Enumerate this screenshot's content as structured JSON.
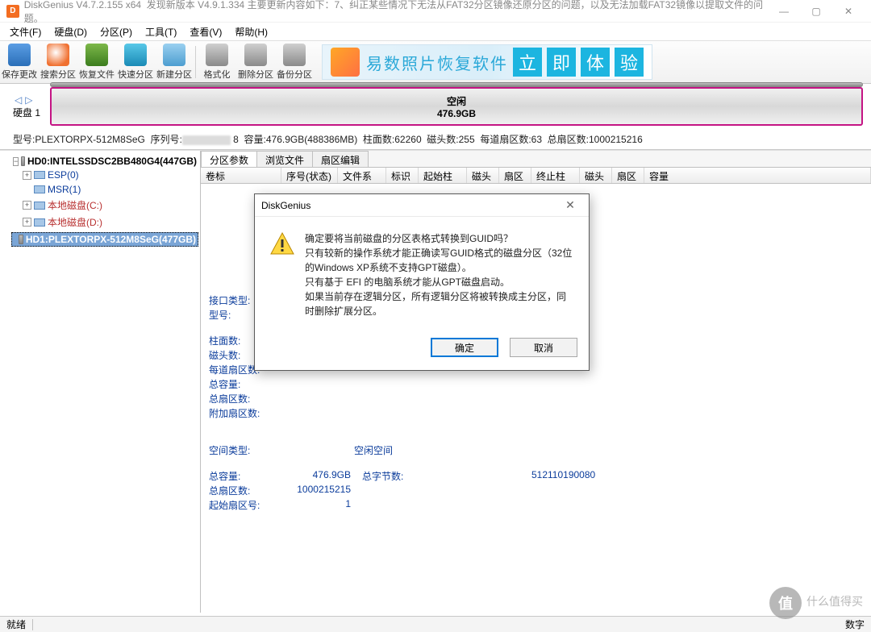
{
  "titlebar": {
    "app_name": "DiskGenius V4.7.2.155 x64",
    "update_text": "发现新版本 V4.9.1.334 主要更新内容如下：7、纠正某些情况下无法从FAT32分区镜像还原分区的问题，以及无法加载FAT32镜像以提取文件的问题。"
  },
  "menu": {
    "file": "文件(F)",
    "disk": "硬盘(D)",
    "partition": "分区(P)",
    "tools": "工具(T)",
    "view": "查看(V)",
    "help": "帮助(H)"
  },
  "toolbar": {
    "save": "保存更改",
    "search": "搜索分区",
    "recover": "恢复文件",
    "quick": "快速分区",
    "new": "新建分区",
    "format": "格式化",
    "delete": "删除分区",
    "backup": "备份分区"
  },
  "banner": {
    "text": "易数照片恢复软件",
    "b1": "立",
    "b2": "即",
    "b3": "体",
    "b4": "验"
  },
  "diskbar": {
    "label": "硬盘 1",
    "free": "空闲",
    "size": "476.9GB"
  },
  "disk_info": "型号:PLEXTORPX-512M8SeG  序列号:                8  容量:476.9GB(488386MB)  柱面数:62260  磁头数:255  每道扇区数:63  总扇区数:1000215216",
  "tree": {
    "hd0": "HD0:INTELSSDSC2BB480G4(447GB)",
    "esp": "ESP(0)",
    "msr": "MSR(1)",
    "localc": "本地磁盘(C:)",
    "locald": "本地磁盘(D:)",
    "hd1": "HD1:PLEXTORPX-512M8SeG(477GB)"
  },
  "tabs": {
    "t1": "分区参数",
    "t2": "浏览文件",
    "t3": "扇区编辑"
  },
  "cols": {
    "c1": "卷标",
    "c2": "序号(状态)",
    "c3": "文件系统",
    "c4": "标识",
    "c5": "起始柱面",
    "c6": "磁头",
    "c7": "扇区",
    "c8": "终止柱面",
    "c9": "磁头",
    "c10": "扇区",
    "c11": "容量"
  },
  "info": {
    "iface": "接口类型:",
    "model": "型号:",
    "cyl": "柱面数:",
    "heads": "磁头数:",
    "spt": "每道扇区数:",
    "totalcap": "总容量:",
    "totalsec": "总扇区数:",
    "addsec": "附加扇区数:",
    "spacetype_lbl": "空间类型:",
    "spacetype_val": "空闲空间",
    "totcap_lbl": "总容量:",
    "totcap_val": "476.9GB",
    "totbytes_lbl": "总字节数:",
    "totbytes_val": "512110190080",
    "totsec_lbl": "总扇区数:",
    "totsec_val": "1000215215",
    "startsec_lbl": "起始扇区号:",
    "startsec_val": "1"
  },
  "dialog": {
    "title": "DiskGenius",
    "line1": "确定要将当前磁盘的分区表格式转换到GUID吗？",
    "line2": "只有较新的操作系统才能正确读写GUID格式的磁盘分区（32位的Windows XP系统不支持GPT磁盘）。",
    "line3": "只有基于 EFI 的电脑系统才能从GPT磁盘启动。",
    "line4": "如果当前存在逻辑分区，所有逻辑分区将被转换成主分区，同时删除扩展分区。",
    "ok": "确定",
    "cancel": "取消"
  },
  "status": {
    "ready": "就绪",
    "num": "数字"
  },
  "watermark": {
    "icon": "值",
    "text": "什么值得买"
  }
}
